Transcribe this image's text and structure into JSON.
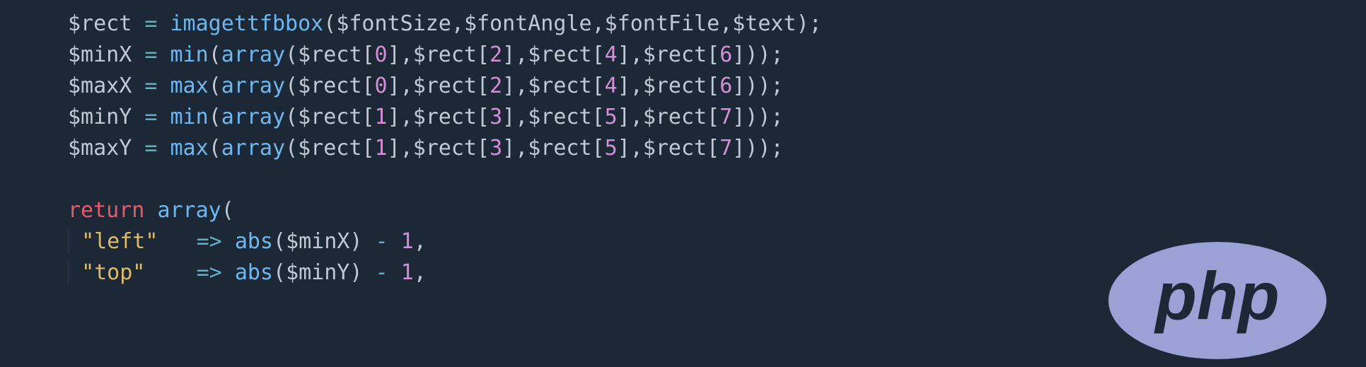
{
  "code": {
    "lines": [
      {
        "indent": 0,
        "tokens": [
          {
            "t": "$rect",
            "c": "v"
          },
          {
            "t": " ",
            "c": "v"
          },
          {
            "t": "=",
            "c": "op"
          },
          {
            "t": " ",
            "c": "v"
          },
          {
            "t": "imagettfbbox",
            "c": "fn"
          },
          {
            "t": "(",
            "c": "p"
          },
          {
            "t": "$fontSize",
            "c": "v"
          },
          {
            "t": ",",
            "c": "p"
          },
          {
            "t": "$fontAngle",
            "c": "v"
          },
          {
            "t": ",",
            "c": "p"
          },
          {
            "t": "$fontFile",
            "c": "v"
          },
          {
            "t": ",",
            "c": "p"
          },
          {
            "t": "$text",
            "c": "v"
          },
          {
            "t": ")",
            "c": "p"
          },
          {
            "t": ";",
            "c": "p"
          }
        ]
      },
      {
        "indent": 0,
        "tokens": [
          {
            "t": "$minX",
            "c": "v"
          },
          {
            "t": " ",
            "c": "v"
          },
          {
            "t": "=",
            "c": "op"
          },
          {
            "t": " ",
            "c": "v"
          },
          {
            "t": "min",
            "c": "fn"
          },
          {
            "t": "(",
            "c": "p"
          },
          {
            "t": "array",
            "c": "fn"
          },
          {
            "t": "(",
            "c": "p"
          },
          {
            "t": "$rect",
            "c": "v"
          },
          {
            "t": "[",
            "c": "p"
          },
          {
            "t": "0",
            "c": "num"
          },
          {
            "t": "]",
            "c": "p"
          },
          {
            "t": ",",
            "c": "p"
          },
          {
            "t": "$rect",
            "c": "v"
          },
          {
            "t": "[",
            "c": "p"
          },
          {
            "t": "2",
            "c": "num"
          },
          {
            "t": "]",
            "c": "p"
          },
          {
            "t": ",",
            "c": "p"
          },
          {
            "t": "$rect",
            "c": "v"
          },
          {
            "t": "[",
            "c": "p"
          },
          {
            "t": "4",
            "c": "num"
          },
          {
            "t": "]",
            "c": "p"
          },
          {
            "t": ",",
            "c": "p"
          },
          {
            "t": "$rect",
            "c": "v"
          },
          {
            "t": "[",
            "c": "p"
          },
          {
            "t": "6",
            "c": "num"
          },
          {
            "t": "]",
            "c": "p"
          },
          {
            "t": ")",
            "c": "p"
          },
          {
            "t": ")",
            "c": "p"
          },
          {
            "t": ";",
            "c": "p"
          }
        ]
      },
      {
        "indent": 0,
        "tokens": [
          {
            "t": "$maxX",
            "c": "v"
          },
          {
            "t": " ",
            "c": "v"
          },
          {
            "t": "=",
            "c": "op"
          },
          {
            "t": " ",
            "c": "v"
          },
          {
            "t": "max",
            "c": "fn"
          },
          {
            "t": "(",
            "c": "p"
          },
          {
            "t": "array",
            "c": "fn"
          },
          {
            "t": "(",
            "c": "p"
          },
          {
            "t": "$rect",
            "c": "v"
          },
          {
            "t": "[",
            "c": "p"
          },
          {
            "t": "0",
            "c": "num"
          },
          {
            "t": "]",
            "c": "p"
          },
          {
            "t": ",",
            "c": "p"
          },
          {
            "t": "$rect",
            "c": "v"
          },
          {
            "t": "[",
            "c": "p"
          },
          {
            "t": "2",
            "c": "num"
          },
          {
            "t": "]",
            "c": "p"
          },
          {
            "t": ",",
            "c": "p"
          },
          {
            "t": "$rect",
            "c": "v"
          },
          {
            "t": "[",
            "c": "p"
          },
          {
            "t": "4",
            "c": "num"
          },
          {
            "t": "]",
            "c": "p"
          },
          {
            "t": ",",
            "c": "p"
          },
          {
            "t": "$rect",
            "c": "v"
          },
          {
            "t": "[",
            "c": "p"
          },
          {
            "t": "6",
            "c": "num"
          },
          {
            "t": "]",
            "c": "p"
          },
          {
            "t": ")",
            "c": "p"
          },
          {
            "t": ")",
            "c": "p"
          },
          {
            "t": ";",
            "c": "p"
          }
        ]
      },
      {
        "indent": 0,
        "tokens": [
          {
            "t": "$minY",
            "c": "v"
          },
          {
            "t": " ",
            "c": "v"
          },
          {
            "t": "=",
            "c": "op"
          },
          {
            "t": " ",
            "c": "v"
          },
          {
            "t": "min",
            "c": "fn"
          },
          {
            "t": "(",
            "c": "p"
          },
          {
            "t": "array",
            "c": "fn"
          },
          {
            "t": "(",
            "c": "p"
          },
          {
            "t": "$rect",
            "c": "v"
          },
          {
            "t": "[",
            "c": "p"
          },
          {
            "t": "1",
            "c": "num"
          },
          {
            "t": "]",
            "c": "p"
          },
          {
            "t": ",",
            "c": "p"
          },
          {
            "t": "$rect",
            "c": "v"
          },
          {
            "t": "[",
            "c": "p"
          },
          {
            "t": "3",
            "c": "num"
          },
          {
            "t": "]",
            "c": "p"
          },
          {
            "t": ",",
            "c": "p"
          },
          {
            "t": "$rect",
            "c": "v"
          },
          {
            "t": "[",
            "c": "p"
          },
          {
            "t": "5",
            "c": "num"
          },
          {
            "t": "]",
            "c": "p"
          },
          {
            "t": ",",
            "c": "p"
          },
          {
            "t": "$rect",
            "c": "v"
          },
          {
            "t": "[",
            "c": "p"
          },
          {
            "t": "7",
            "c": "num"
          },
          {
            "t": "]",
            "c": "p"
          },
          {
            "t": ")",
            "c": "p"
          },
          {
            "t": ")",
            "c": "p"
          },
          {
            "t": ";",
            "c": "p"
          }
        ]
      },
      {
        "indent": 0,
        "tokens": [
          {
            "t": "$maxY",
            "c": "v"
          },
          {
            "t": " ",
            "c": "v"
          },
          {
            "t": "=",
            "c": "op"
          },
          {
            "t": " ",
            "c": "v"
          },
          {
            "t": "max",
            "c": "fn"
          },
          {
            "t": "(",
            "c": "p"
          },
          {
            "t": "array",
            "c": "fn"
          },
          {
            "t": "(",
            "c": "p"
          },
          {
            "t": "$rect",
            "c": "v"
          },
          {
            "t": "[",
            "c": "p"
          },
          {
            "t": "1",
            "c": "num"
          },
          {
            "t": "]",
            "c": "p"
          },
          {
            "t": ",",
            "c": "p"
          },
          {
            "t": "$rect",
            "c": "v"
          },
          {
            "t": "[",
            "c": "p"
          },
          {
            "t": "3",
            "c": "num"
          },
          {
            "t": "]",
            "c": "p"
          },
          {
            "t": ",",
            "c": "p"
          },
          {
            "t": "$rect",
            "c": "v"
          },
          {
            "t": "[",
            "c": "p"
          },
          {
            "t": "5",
            "c": "num"
          },
          {
            "t": "]",
            "c": "p"
          },
          {
            "t": ",",
            "c": "p"
          },
          {
            "t": "$rect",
            "c": "v"
          },
          {
            "t": "[",
            "c": "p"
          },
          {
            "t": "7",
            "c": "num"
          },
          {
            "t": "]",
            "c": "p"
          },
          {
            "t": ")",
            "c": "p"
          },
          {
            "t": ")",
            "c": "p"
          },
          {
            "t": ";",
            "c": "p"
          }
        ]
      },
      {
        "indent": 0,
        "tokens": []
      },
      {
        "indent": 0,
        "tokens": [
          {
            "t": "return",
            "c": "kw"
          },
          {
            "t": " ",
            "c": "v"
          },
          {
            "t": "array",
            "c": "fn"
          },
          {
            "t": "(",
            "c": "p"
          }
        ]
      },
      {
        "indent": 1,
        "tokens": [
          {
            "t": "\"left\"",
            "c": "str"
          },
          {
            "t": "   ",
            "c": "v"
          },
          {
            "t": "=>",
            "c": "op"
          },
          {
            "t": " ",
            "c": "v"
          },
          {
            "t": "abs",
            "c": "fn"
          },
          {
            "t": "(",
            "c": "p"
          },
          {
            "t": "$minX",
            "c": "v"
          },
          {
            "t": ")",
            "c": "p"
          },
          {
            "t": " ",
            "c": "v"
          },
          {
            "t": "-",
            "c": "op"
          },
          {
            "t": " ",
            "c": "v"
          },
          {
            "t": "1",
            "c": "num"
          },
          {
            "t": ",",
            "c": "p"
          }
        ]
      },
      {
        "indent": 1,
        "tokens": [
          {
            "t": "\"top\"",
            "c": "str"
          },
          {
            "t": "    ",
            "c": "v"
          },
          {
            "t": "=>",
            "c": "op"
          },
          {
            "t": " ",
            "c": "v"
          },
          {
            "t": "abs",
            "c": "fn"
          },
          {
            "t": "(",
            "c": "p"
          },
          {
            "t": "$minY",
            "c": "v"
          },
          {
            "t": ")",
            "c": "p"
          },
          {
            "t": " ",
            "c": "v"
          },
          {
            "t": "-",
            "c": "op"
          },
          {
            "t": " ",
            "c": "v"
          },
          {
            "t": "1",
            "c": "num"
          },
          {
            "t": ",",
            "c": "p"
          }
        ]
      }
    ]
  },
  "logo": {
    "text": "php",
    "fill": "#9aa1d4",
    "textColor": "#1c2836"
  }
}
